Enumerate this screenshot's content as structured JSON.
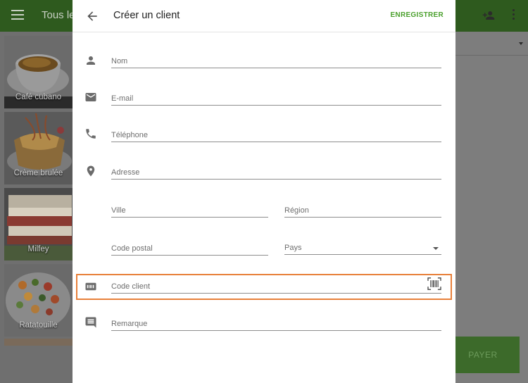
{
  "background": {
    "toolbar_title": "Tous les",
    "tiles": [
      {
        "label": "Café cubano"
      },
      {
        "label": "Crème brulée"
      },
      {
        "label": "Milfey"
      },
      {
        "label": "Ratatouille"
      }
    ],
    "pay_label": "PAYER"
  },
  "dialog": {
    "title": "Créer un client",
    "save_label": "ENREGISTRER",
    "fields": {
      "name": {
        "placeholder": "Nom",
        "value": ""
      },
      "email": {
        "placeholder": "E-mail",
        "value": ""
      },
      "phone": {
        "placeholder": "Téléphone",
        "value": ""
      },
      "address": {
        "placeholder": "Adresse",
        "value": ""
      },
      "city": {
        "placeholder": "Ville",
        "value": ""
      },
      "region": {
        "placeholder": "Région",
        "value": ""
      },
      "postal_code": {
        "placeholder": "Code postal",
        "value": ""
      },
      "country": {
        "placeholder": "Pays",
        "value": ""
      },
      "customer_code": {
        "placeholder": "Code client",
        "value": ""
      },
      "note": {
        "placeholder": "Remarque",
        "value": ""
      }
    }
  },
  "colors": {
    "accent": "#4aa02c",
    "highlight": "#e8803a",
    "toolbar_dimmed": "#2e5a1e"
  }
}
